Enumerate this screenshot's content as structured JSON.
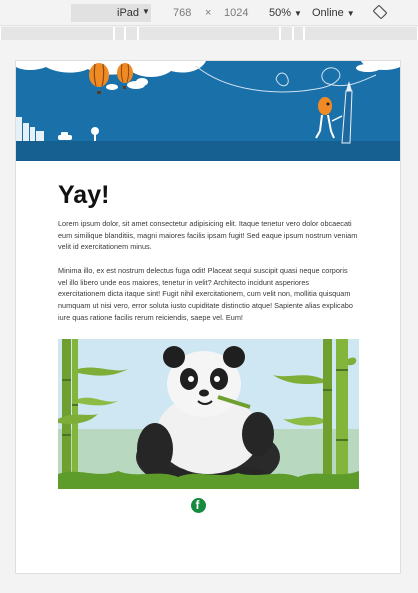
{
  "toolbar": {
    "device": "iPad",
    "width": "768",
    "times": "×",
    "height": "1024",
    "zoom": "50%",
    "network": "Online"
  },
  "email": {
    "heading": "Yay!",
    "paragraph_1": "Lorem ipsum dolor, sit amet consectetur adipisicing elit. Itaque tenetur vero dolor obcaecati eum similique blanditiis, magni maiores facilis ipsam fugit! Sed eaque ipsum nostrum veniam velit id exercitationem minus.",
    "paragraph_2": "Minima illo, ex est nostrum delectus fuga odit! Placeat sequi suscipit quasi neque corporis vel illo libero unde eos maiores, tenetur in velit? Architecto incidunt asperiores exercitationem dicta itaque sint! Fugit nihil exercitationem, cum velit non, mollitia quisquam numquam ut nisi vero, error soluta iusto cupiditate distinctio atque! Sapiente alias explicabo iure quas ratione facilis rerum reiciendis, saepe vel. Eum!",
    "social_icon": "facebook-icon",
    "social_glyph": "f"
  },
  "colors": {
    "header_blue": "#1a71a9",
    "facebook_green": "#168a3f"
  }
}
